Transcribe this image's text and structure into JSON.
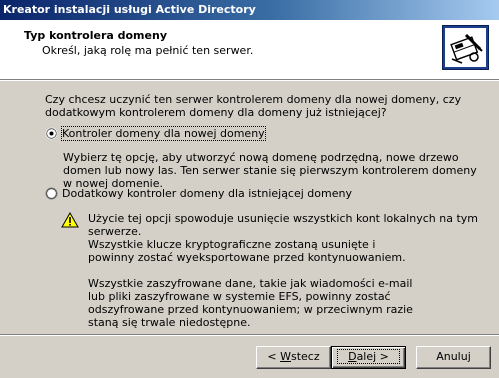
{
  "window": {
    "title": "Kreator instalacji usługi Active Directory"
  },
  "header": {
    "title": "Typ kontrolera domeny",
    "subtitle": "Określ, jaką rolę ma pełnić ten serwer."
  },
  "question": "Czy chcesz uczynić ten serwer kontrolerem domeny dla nowej domeny, czy dodatkowym kontrolerem domeny dla domeny już istniejącej?",
  "options": [
    {
      "label": "Kontroler domeny dla nowej domeny",
      "selected": true,
      "description": "Wybierz tę opcję, aby utworzyć nową domenę podrzędną, nowe drzewo domen lub nowy las. Ten serwer stanie się pierwszym kontrolerem domeny w nowej domenie."
    },
    {
      "label": "Dodatkowy kontroler domeny dla istniejącej domeny",
      "selected": false,
      "warning": "Użycie tej opcji spowoduje usunięcie wszystkich kont lokalnych na tym serwerze.",
      "notes": [
        "Wszystkie klucze kryptograficzne zostaną usunięte i powinny zostać wyeksportowane przed kontynuowaniem.",
        "Wszystkie zaszyfrowane dane, takie jak wiadomości e-mail lub pliki zaszyfrowane w systemie EFS, powinny zostać odszyfrowane przed kontynuowaniem; w przeciwnym razie staną się trwale niedostępne."
      ]
    }
  ],
  "buttons": {
    "back_prefix": "< ",
    "back_hotkey": "W",
    "back_rest": "stecz",
    "next_hotkey": "D",
    "next_rest": "alej >",
    "cancel": "Anuluj"
  },
  "icons": {
    "header": "directory-book-icon",
    "warning": "warning-triangle-icon"
  }
}
